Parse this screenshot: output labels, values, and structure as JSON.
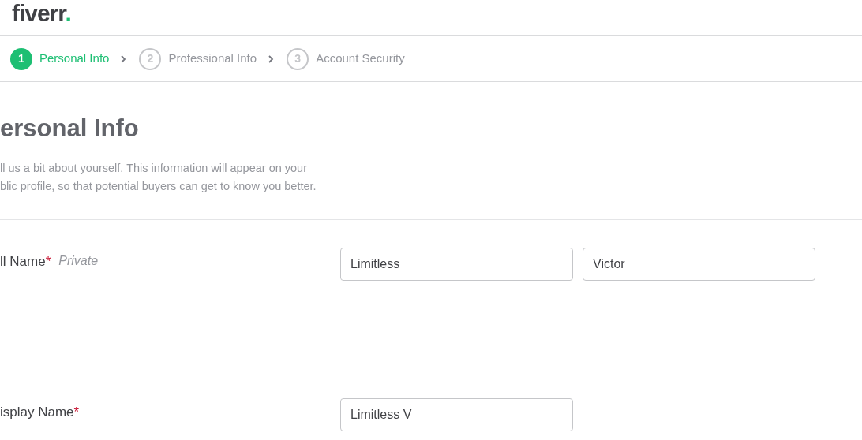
{
  "logo": {
    "text": "fiverr",
    "dot": "."
  },
  "steps": [
    {
      "number": "1",
      "label": "Personal Info",
      "selected": true
    },
    {
      "number": "2",
      "label": "Professional Info",
      "selected": false
    },
    {
      "number": "3",
      "label": "Account Security",
      "selected": false
    }
  ],
  "section": {
    "title": "ersonal Info",
    "description": [
      "ll us a bit about yourself. This information will appear on your",
      "blic profile, so that potential buyers can get to know you better."
    ]
  },
  "fields": [
    {
      "label": "ll Name",
      "required_mark": "*",
      "note": "Private",
      "inputs": [
        "Limitless",
        "Victor"
      ]
    },
    {
      "label": "isplay Name",
      "required_mark": "*",
      "inputs": [
        "Limitless V"
      ]
    }
  ]
}
